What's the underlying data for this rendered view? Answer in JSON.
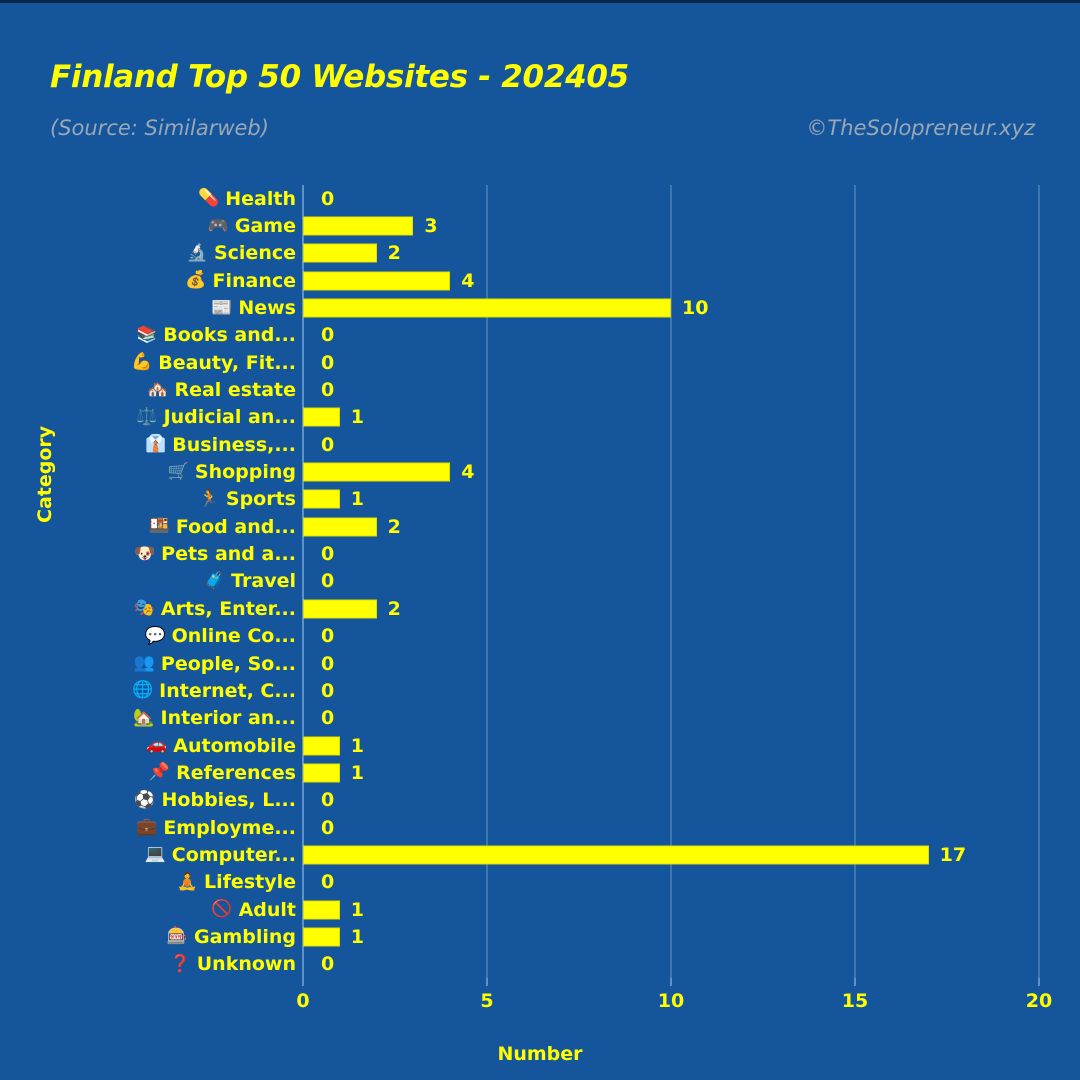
{
  "header": {
    "title": "Finland Top 50 Websites - 202405",
    "subtitle": "(Source: Similarweb)",
    "credit": "©TheSolopreneur.xyz"
  },
  "colors": {
    "background": "#15559b",
    "bar": "#ffff00",
    "text": "#ffff00",
    "muted_text": "#9aa7b4",
    "gridline": "#3c77b4"
  },
  "chart_data": {
    "type": "bar",
    "orientation": "horizontal",
    "title": "Finland Top 50 Websites - 202405",
    "subtitle": "(Source: Similarweb)",
    "xlabel": "Number",
    "ylabel": "Category",
    "xlim": [
      0,
      20
    ],
    "xticks": [
      0,
      5,
      10,
      15,
      20
    ],
    "xticklabels": [
      "0",
      "5",
      "10",
      "15",
      "20"
    ],
    "grid": true,
    "legend": null,
    "show_value_labels": true,
    "categories": [
      "Health",
      "Game",
      "Science",
      "Finance",
      "News",
      "Books and...",
      "Beauty, Fit...",
      "Real estate",
      "Judicial an...",
      "Business,...",
      "Shopping",
      "Sports",
      "Food and...",
      "Pets and a...",
      "Travel",
      "Arts, Enter...",
      "Online Co...",
      "People, So...",
      "Internet, C...",
      "Interior an...",
      "Automobile",
      "References",
      "Hobbies, L...",
      "Employme...",
      "Computer...",
      "Lifestyle",
      "Adult",
      "Gambling",
      "Unknown"
    ],
    "icons": [
      "💊",
      "🎮",
      "🔬",
      "💰",
      "📰",
      "📚",
      "💪",
      "🏘️",
      "⚖️",
      "👔",
      "🛒",
      "🏃",
      "🍱",
      "🐶",
      "🧳",
      "🎭",
      "💬",
      "👥",
      "🌐",
      "🏡",
      "🚗",
      "📌",
      "⚽",
      "💼",
      "💻",
      "🧘",
      "🚫",
      "🎰",
      "❓"
    ],
    "icon_names": [
      "pill-icon",
      "game-controller-icon",
      "microscope-icon",
      "money-bag-icon",
      "newspaper-icon",
      "books-icon",
      "flexed-biceps-icon",
      "houses-icon",
      "balance-scale-icon",
      "necktie-icon",
      "shopping-cart-icon",
      "runner-icon",
      "bento-box-icon",
      "dog-face-icon",
      "luggage-icon",
      "performing-arts-icon",
      "speech-balloon-icon",
      "people-icon",
      "globe-icon",
      "house-with-garden-icon",
      "car-icon",
      "pushpin-icon",
      "soccer-ball-icon",
      "briefcase-icon",
      "laptop-icon",
      "person-meditating-icon",
      "no-entry-icon",
      "slot-machine-icon",
      "question-mark-icon"
    ],
    "values": [
      0,
      3,
      2,
      4,
      10,
      0,
      0,
      0,
      1,
      0,
      4,
      1,
      2,
      0,
      0,
      2,
      0,
      0,
      0,
      0,
      1,
      1,
      0,
      0,
      17,
      0,
      1,
      1,
      0
    ],
    "value_labels": [
      "0",
      "3",
      "2",
      "4",
      "10",
      "0",
      "0",
      "0",
      "1",
      "0",
      "4",
      "1",
      "2",
      "0",
      "0",
      "2",
      "0",
      "0",
      "0",
      "0",
      "1",
      "1",
      "0",
      "0",
      "17",
      "0",
      "1",
      "1",
      "0"
    ]
  }
}
